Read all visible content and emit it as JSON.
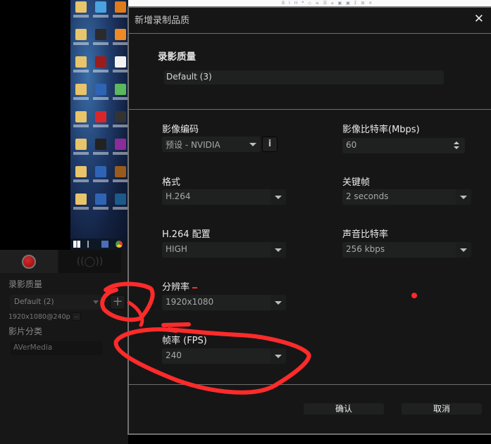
{
  "background": {
    "document_toolbar_glyphs": "B I H ❝ ◇ ≡ ☰ ⌀ ▣ ▣ Σ ⊞ ✕"
  },
  "desktop": {
    "icon_colors": [
      "#e8c46a",
      "#4aa3df",
      "#e07b1a",
      "#e8c46a",
      "#2b2b2b",
      "#f08a24",
      "#e8c46a",
      "#9b1c1c",
      "#f2f2f2",
      "#e8c46a",
      "#2f64b5",
      "#5cb85c",
      "#e8c46a",
      "#d8272b",
      "#333333",
      "#e8c46a",
      "#222222",
      "#8a2c9a",
      "#e8c46a",
      "#2f64b5",
      "#9a5a1c",
      "#e8c46a",
      "#2f64b5",
      "#1b5a8a"
    ],
    "taskbar_icons": [
      "windows-start-icon",
      "task-view-icon",
      "bird-app-icon",
      "chrome-icon"
    ]
  },
  "left_panel": {
    "tabs": [
      {
        "name": "record",
        "icon": "record-dot-icon",
        "active": true
      },
      {
        "name": "stream",
        "icon": "broadcast-icon",
        "glyph": "((◯))",
        "active": false
      }
    ],
    "quality_label": "录影质量",
    "quality_value": "Default (2)",
    "add_button": "+",
    "resolution_text": "1920x1080@240p",
    "more_button": "...",
    "category_label": "影片分类",
    "category_value": "AVerMedia"
  },
  "dialog": {
    "title": "新增录制品质",
    "close": "✕",
    "section_title": "录影质量",
    "name_value": "Default (3)",
    "fields": {
      "encoder": {
        "label": "影像编码",
        "value": "预设 - NVIDIA",
        "info": "i"
      },
      "video_bitrate": {
        "label": "影像比特率(Mbps)",
        "value": "60"
      },
      "format": {
        "label": "格式",
        "value": "H.264"
      },
      "keyframe": {
        "label": "关键帧",
        "value": "2 seconds"
      },
      "profile": {
        "label": "H.264 配置",
        "value": "HIGH"
      },
      "audio_bitrate": {
        "label": "声音比特率",
        "value": "256 kbps"
      },
      "resolution": {
        "label": "分辨率",
        "value": "1920x1080"
      },
      "fps": {
        "label": "帧率 (FPS)",
        "value": "240"
      }
    },
    "confirm": "确认",
    "cancel": "取消"
  },
  "annotation": {
    "color": "#ff2b2b"
  }
}
